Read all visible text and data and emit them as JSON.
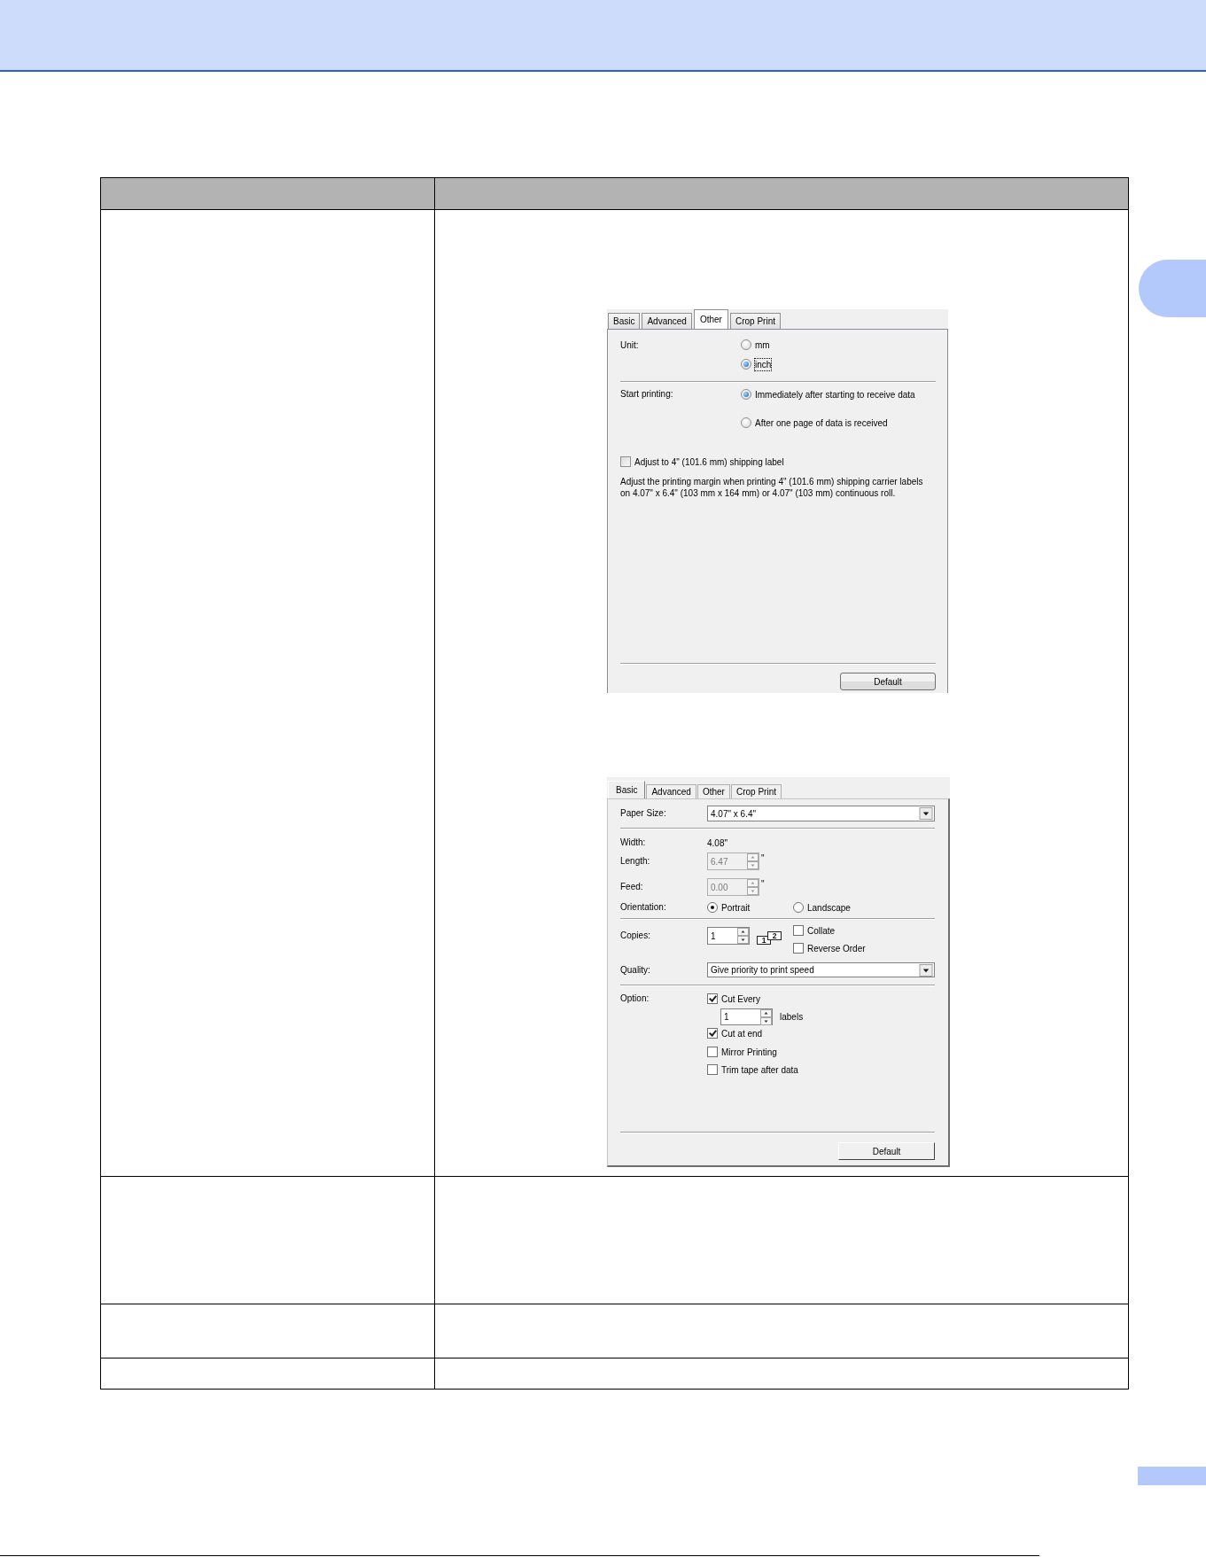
{
  "dialogs": [
    {
      "kind": "other",
      "tabs": [
        {
          "label": "Basic",
          "selected": false
        },
        {
          "label": "Advanced",
          "selected": false
        },
        {
          "label": "Other",
          "selected": true
        },
        {
          "label": "Crop Print",
          "selected": false
        }
      ],
      "unit": {
        "label": "Unit:",
        "options": [
          {
            "label": "mm",
            "selected": false,
            "focused": false
          },
          {
            "label": "inch",
            "selected": true,
            "focused": true
          }
        ]
      },
      "start_printing": {
        "label": "Start printing:",
        "options": [
          {
            "label": "Immediately after starting to receive data",
            "selected": true
          },
          {
            "label": "After one page of data is received",
            "selected": false
          }
        ]
      },
      "shipping_label": {
        "label": "Adjust to 4\" (101.6 mm) shipping label",
        "checked": false
      },
      "description": "Adjust the printing margin when printing 4\" (101.6 mm) shipping carrier labels on 4.07\" x 6.4\" (103 mm x 164 mm) or 4.07\" (103 mm) continuous roll.",
      "default_button": "Default"
    },
    {
      "kind": "basic",
      "tabs": [
        {
          "label": "Basic",
          "selected": true
        },
        {
          "label": "Advanced",
          "selected": false
        },
        {
          "label": "Other",
          "selected": false
        },
        {
          "label": "Crop Print",
          "selected": false
        }
      ],
      "paper_size": {
        "label": "Paper Size:",
        "value": "4.07\" x 6.4\""
      },
      "width": {
        "label": "Width:",
        "value": "4.08\""
      },
      "length": {
        "label": "Length:",
        "value": "6.47",
        "unit": "\"",
        "disabled": true
      },
      "feed": {
        "label": "Feed:",
        "value": "0.00",
        "unit": "\"",
        "disabled": true
      },
      "orientation": {
        "label": "Orientation:",
        "options": [
          {
            "label": "Portrait",
            "selected": true
          },
          {
            "label": "Landscape",
            "selected": false
          }
        ]
      },
      "copies": {
        "label": "Copies:",
        "value": "1",
        "collate_pages": [
          "1",
          "2"
        ]
      },
      "copy_options": [
        {
          "label": "Collate",
          "checked": false
        },
        {
          "label": "Reverse Order",
          "checked": false
        }
      ],
      "quality": {
        "label": "Quality:",
        "value": "Give priority to print speed"
      },
      "option": {
        "label": "Option:",
        "cut_every": {
          "label": "Cut Every",
          "checked": true,
          "value": "1",
          "unit": "labels"
        },
        "checkboxes": [
          {
            "label": "Cut at end",
            "checked": true
          },
          {
            "label": "Mirror Printing",
            "checked": false
          },
          {
            "label": "Trim tape after data",
            "checked": false
          }
        ]
      },
      "default_button": "Default"
    }
  ]
}
